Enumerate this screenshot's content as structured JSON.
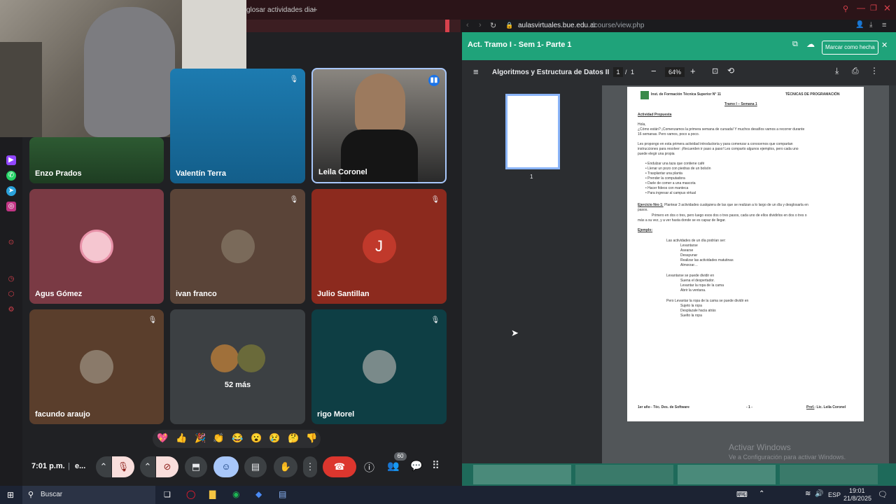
{
  "browser": {
    "left_tab_title": "glosar actividades dia",
    "new_tab_icon": "plus-icon",
    "url_domain": "aulasvirtuales.bue.edu.ar",
    "url_path": "/course/view.php",
    "window_controls": [
      "search-icon",
      "minimize-icon",
      "restore-icon",
      "close-icon"
    ]
  },
  "meet": {
    "participants": [
      {
        "name": "Enzo Prados",
        "muted": false
      },
      {
        "name": "Valentín Terra",
        "muted": true
      },
      {
        "name": "Leila Coronel",
        "muted": false,
        "speaking": true
      },
      {
        "name": "Agus Gómez",
        "muted": false
      },
      {
        "name": "ivan franco",
        "muted": true
      },
      {
        "name": "Julio Santillan",
        "muted": true,
        "initial": "J"
      },
      {
        "name": "facundo araujo",
        "muted": true
      },
      {
        "name": "52 más",
        "muted": false
      },
      {
        "name": "rigo Morel",
        "muted": true
      }
    ],
    "reactions": [
      "💖",
      "👍",
      "🎉",
      "👏",
      "😂",
      "😮",
      "😢",
      "🤔",
      "👎"
    ],
    "time": "7:01 p.m.",
    "separator": "|",
    "meeting_code": "e...",
    "people_count": "60"
  },
  "pdf": {
    "activity_title": "Act. Tramo I - Sem 1- Parte 1",
    "mark_done": "Marcar como hecha",
    "doc_title": "Algoritmos y Estructura de Datos II",
    "page_current": "1",
    "page_sep": "/",
    "page_total": "1",
    "zoom": "64%",
    "thumb_label": "1",
    "page": {
      "inst": "Inst. de Formación Técnica Superior N° 11",
      "program": "TÉCNICAS DE PROGRAMACIÓN",
      "tramo": "Tramo I – Semana 1",
      "heading": "Actividad Propuesta",
      "hola": "Hola,",
      "p1a": "¿Cómo están? ¡Comenzamos la primera semana de cursada! Y muchos desafíos vamos a recorrer durante",
      "p1b": "16 semanas. Pero vamos, poco a poco.",
      "p2a": "Les propongo en esta primera actividad introductoria y para comenzar a conocernos que compartan",
      "p2b": "instrucciones para resolver: ¡Recuerden ir paso a paso! Les comparto algunos ejemplos, pero cada uno",
      "p2c": "puede elegir una propia",
      "bullets": [
        "Endulzar una taza que contiene café",
        "Llenar un pozo con piedras de un bolsón",
        "Trasplantar una planta",
        "Prender la computadora",
        "Darle de comer a una mascota",
        "Hacer fideos con manteca",
        "Para ingresar al campus virtual"
      ],
      "ej_label": "Ejercicio Nro 1:",
      "ej_text": " Plantear 3 actividades cualquiera de las que se realizan a lo largo de un día y desglosarla en",
      "ej_text2": "pasos.",
      "ej_p2a": "Primero en dos o tres, pero luego esos dos o tres pasos, cada uno de ellos dividirlos en dos o tres o",
      "ej_p2b": "más a su vez, y a ver hasta donde se es capaz de llegar.",
      "ejemplo": "Ejemplo:",
      "l1": "Las actividades de un día podrían ser:",
      "l1items": [
        "Levantarse",
        "Asearse",
        "Desayunar",
        "Realizar las actividades matutinas",
        "Almorzar…"
      ],
      "l2": "Levantarse se puede dividir en",
      "l2items": [
        "Suena el despertador.",
        "Levantar la ropa de la cama",
        "Abrir la ventana."
      ],
      "l3": "Pero Levantar la ropa de la cama se puede dividir en",
      "l3items": [
        "Sujeto la ropa",
        "Desplazale hacia atrás",
        "Suelto la ropa"
      ],
      "foot_left": "1er año - Téc. Des. de Software",
      "foot_mid": "- 1 -",
      "foot_right_label": "Prof.",
      "foot_right": ": Lic. Leila Coronel"
    }
  },
  "watermark": {
    "line1": "Activar Windows",
    "line2": "Ve a Configuración para activar Windows."
  },
  "taskbar": {
    "search_placeholder": "Buscar",
    "lang": "ESP",
    "time": "19:01",
    "date": "21/8/2025"
  }
}
